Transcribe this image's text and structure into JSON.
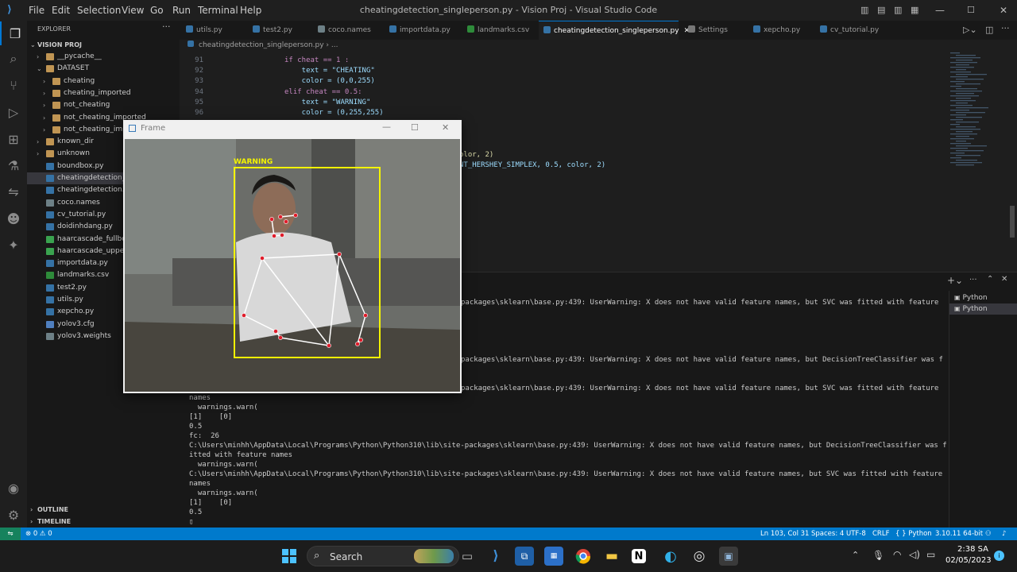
{
  "window": {
    "title": "cheatingdetection_singleperson.py - Vision Proj - Visual Studio Code",
    "menu": [
      "File",
      "Edit",
      "Selection",
      "View",
      "Go",
      "Run",
      "Terminal",
      "Help"
    ]
  },
  "sidebar": {
    "header": "EXPLORER",
    "project": "VISION PROJ",
    "items": [
      {
        "label": "__pycache__",
        "kind": "folder"
      },
      {
        "label": "DATASET",
        "kind": "folder-open"
      },
      {
        "label": "cheating",
        "kind": "folder"
      },
      {
        "label": "cheating_imported",
        "kind": "folder"
      },
      {
        "label": "not_cheating",
        "kind": "folder"
      },
      {
        "label": "not_cheating_imported",
        "kind": "folder"
      },
      {
        "label": "not_cheating_impo",
        "kind": "folder"
      },
      {
        "label": "known_dir",
        "kind": "folder"
      },
      {
        "label": "unknown",
        "kind": "folder"
      },
      {
        "label": "boundbox.py",
        "kind": "py"
      },
      {
        "label": "cheatingdetection_si",
        "kind": "py"
      },
      {
        "label": "cheatingdetection.py",
        "kind": "py"
      },
      {
        "label": "coco.names",
        "kind": "txt"
      },
      {
        "label": "cv_tutorial.py",
        "kind": "py"
      },
      {
        "label": "doidinhdang.py",
        "kind": "py"
      },
      {
        "label": "haarcascade_fullbody",
        "kind": "xml"
      },
      {
        "label": "haarcascade_upperb",
        "kind": "xml"
      },
      {
        "label": "importdata.py",
        "kind": "py"
      },
      {
        "label": "landmarks.csv",
        "kind": "csv"
      },
      {
        "label": "test2.py",
        "kind": "py"
      },
      {
        "label": "utils.py",
        "kind": "py"
      },
      {
        "label": "xepcho.py",
        "kind": "py"
      },
      {
        "label": "yolov3.cfg",
        "kind": "cfg"
      },
      {
        "label": "yolov3.weights",
        "kind": "txt"
      }
    ],
    "outline": "OUTLINE",
    "timeline": "TIMELINE"
  },
  "tabs": [
    {
      "label": "utils.py"
    },
    {
      "label": "test2.py"
    },
    {
      "label": "coco.names"
    },
    {
      "label": "importdata.py"
    },
    {
      "label": "landmarks.csv"
    },
    {
      "label": "cheatingdetection_singleperson.py",
      "active": true
    },
    {
      "label": "Settings"
    },
    {
      "label": "xepcho.py"
    },
    {
      "label": "cv_tutorial.py"
    }
  ],
  "breadcrumb": "cheatingdetection_singleperson.py › ...",
  "editor": {
    "line_numbers": [
      "91",
      "92",
      "93",
      "94",
      "95",
      "96"
    ],
    "lines": [
      "if cheat == 1 :",
      "    text = \"CHEATING\"",
      "    color = (0,0,255)",
      "elif cheat == 0.5:",
      "    text = \"WARNING\"",
      "    color = (0,255,255)"
    ],
    "partial_1": "olor, 2)",
    "partial_2": "NT_HERSHEY_SIMPLEX, 0.5, color, 2)"
  },
  "frame_window": {
    "title": "Frame",
    "overlay_label": "WARNING",
    "overlay_color": "#f4f400",
    "keypoint_color": "#e01c2a"
  },
  "terminal": {
    "top_lines": [
      "packages\\sklearn\\base.py:439: UserWarning: X does not have valid feature names, but SVC was fitted with feature",
      "packages\\sklearn\\base.py:439: UserWarning: X does not have valid feature names, but DecisionTreeClassifier was f",
      "packages\\sklearn\\base.py:439: UserWarning: X does not have valid feature names, but SVC was fitted with feature"
    ],
    "lines": [
      "names",
      "  warnings.warn(",
      "[1]    [0]",
      "0.5",
      "fc:  26",
      "C:\\Users\\minhh\\AppData\\Local\\Programs\\Python\\Python310\\lib\\site-packages\\sklearn\\base.py:439: UserWarning: X does not have valid feature names, but DecisionTreeClassifier was f",
      "itted with feature names",
      "  warnings.warn(",
      "C:\\Users\\minhh\\AppData\\Local\\Programs\\Python\\Python310\\lib\\site-packages\\sklearn\\base.py:439: UserWarning: X does not have valid feature names, but SVC was fitted with feature",
      "names",
      "  warnings.warn(",
      "[1]    [0]",
      "0.5",
      "▯"
    ],
    "instances": [
      "Python",
      "Python"
    ]
  },
  "statusbar": {
    "problems": "⊗ 0 ⚠ 0",
    "position": "Ln 103, Col 31",
    "spaces": "Spaces: 4",
    "encoding": "UTF-8",
    "eol": "CRLF",
    "language": "{ } Python",
    "interpreter": "3.10.11 64-bit"
  },
  "taskbar": {
    "search_label": "Search",
    "time": "2:38 SA",
    "date": "02/05/2023"
  },
  "colors": {
    "accent": "#007acc",
    "keyword": "#c586c0",
    "string": "#ce9178",
    "number": "#b5cea8",
    "variable": "#9cdcfe"
  }
}
